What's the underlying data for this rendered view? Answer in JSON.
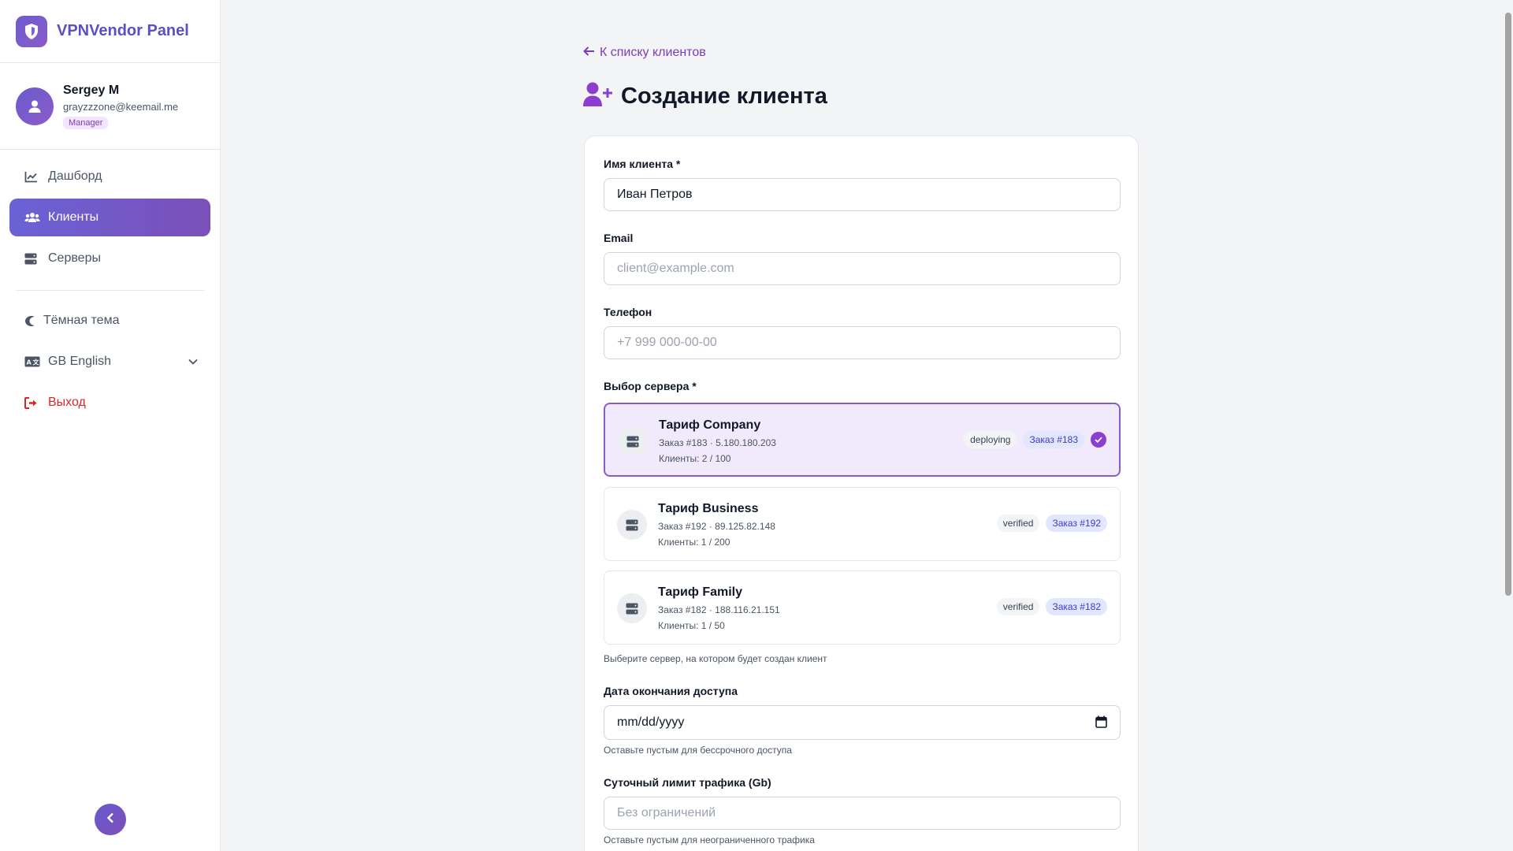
{
  "app": {
    "title": "VPNVendor Panel"
  },
  "user": {
    "name": "Sergey M",
    "email": "grayzzzone@keemail.me",
    "role": "Manager"
  },
  "nav": {
    "items": [
      {
        "label": "Дашборд"
      },
      {
        "label": "Клиенты"
      },
      {
        "label": "Серверы"
      }
    ],
    "theme_label": "Тёмная тема",
    "language_label": "GB English",
    "logout_label": "Выход"
  },
  "page": {
    "back_label": "К списку клиентов",
    "title": "Создание клиента"
  },
  "form": {
    "name": {
      "label": "Имя клиента *",
      "value": "Иван Петров"
    },
    "email": {
      "label": "Email",
      "placeholder": "client@example.com"
    },
    "phone": {
      "label": "Телефон",
      "placeholder": "+7 999 000-00-00"
    },
    "server": {
      "label": "Выбор сервера *",
      "hint": "Выберите сервер, на котором будет создан клиент",
      "options": [
        {
          "title": "Тариф Company",
          "subtitle": "Заказ #183 · 5.180.180.203",
          "clients": "Клиенты: 2 / 100",
          "status": "deploying",
          "order": "Заказ #183",
          "selected": true
        },
        {
          "title": "Тариф Business",
          "subtitle": "Заказ #192 · 89.125.82.148",
          "clients": "Клиенты: 1 / 200",
          "status": "verified",
          "order": "Заказ #192",
          "selected": false
        },
        {
          "title": "Тариф Family",
          "subtitle": "Заказ #182 · 188.116.21.151",
          "clients": "Клиенты: 1 / 50",
          "status": "verified",
          "order": "Заказ #182",
          "selected": false
        }
      ]
    },
    "expiry": {
      "label": "Дата окончания доступа",
      "placeholder": "mm/dd/yyyy",
      "hint": "Оставьте пустым для бессрочного доступа"
    },
    "traffic": {
      "label": "Суточный лимит трафика (Gb)",
      "placeholder": "Без ограничений",
      "hint": "Оставьте пустым для неограниченного трафика"
    }
  },
  "colors": {
    "accent": "#7e3bb8",
    "brand": "#5b4fc4",
    "danger": "#dc2626"
  }
}
